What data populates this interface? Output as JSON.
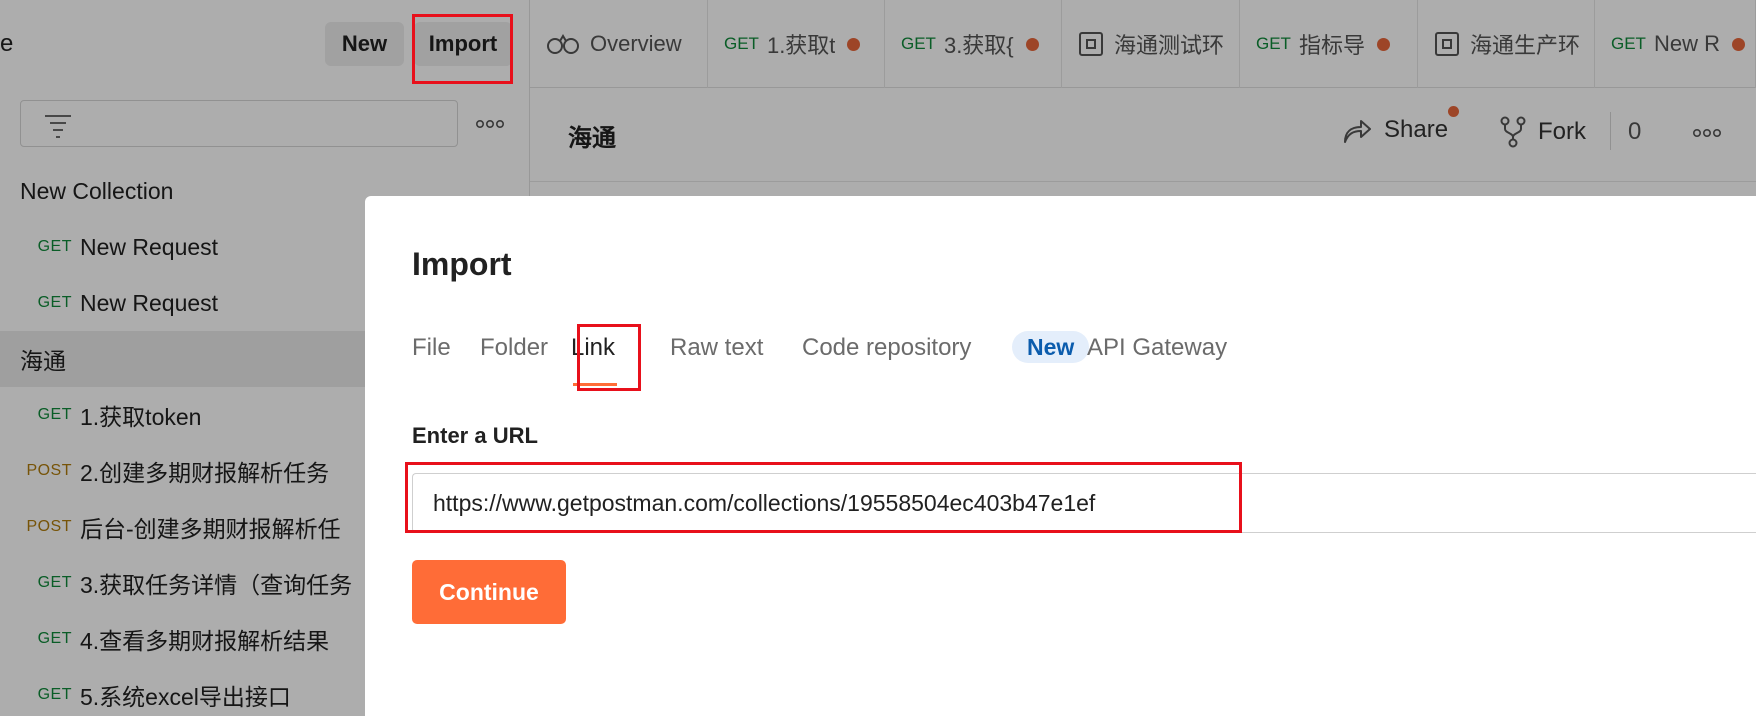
{
  "colors": {
    "accent": "#ff6c37",
    "get_method": "#0f8a3a",
    "post_method": "#b07c0c",
    "unsaved_dot": "#e8663a",
    "highlight_box": "#e8101b",
    "new_badge_bg": "#e4eefb",
    "new_badge_text": "#0b5cad"
  },
  "sidebar": {
    "title_fragment": "e",
    "new_label": "New",
    "import_label": "Import",
    "filter_icon": "filter-icon",
    "more_icon": "more-icon",
    "tree": [
      {
        "kind": "collection",
        "label": "New Collection"
      },
      {
        "kind": "request",
        "method": "GET",
        "label": "New Request"
      },
      {
        "kind": "request",
        "method": "GET",
        "label": "New Request"
      },
      {
        "kind": "collection",
        "label": "海通",
        "active": true
      },
      {
        "kind": "request",
        "method": "GET",
        "label": "1.获取token"
      },
      {
        "kind": "request",
        "method": "POST",
        "label": "2.创建多期财报解析任务"
      },
      {
        "kind": "request",
        "method": "POST",
        "label": "后台-创建多期财报解析任"
      },
      {
        "kind": "request",
        "method": "GET",
        "label": "3.获取任务详情（查询任务"
      },
      {
        "kind": "request",
        "method": "GET",
        "label": "4.查看多期财报解析结果"
      },
      {
        "kind": "request",
        "method": "GET",
        "label": "5.系统excel导出接口"
      }
    ]
  },
  "tabs": [
    {
      "icon": "overview-icon",
      "label": "Overview"
    },
    {
      "method": "GET",
      "label": "1.获取t",
      "unsaved": true
    },
    {
      "method": "GET",
      "label": "3.获取{",
      "unsaved": true
    },
    {
      "icon": "environment-icon",
      "label": "海通测试环"
    },
    {
      "method": "GET",
      "label": "指标导",
      "unsaved": true
    },
    {
      "icon": "environment-icon",
      "label": "海通生产环"
    },
    {
      "method": "GET",
      "label": "New R",
      "unsaved": true
    }
  ],
  "workspace": {
    "title": "海通",
    "share_label": "Share",
    "fork_label": "Fork",
    "fork_count": "0"
  },
  "modal": {
    "title": "Import",
    "tabs": [
      {
        "label": "File"
      },
      {
        "label": "Folder"
      },
      {
        "label": "Link",
        "active": true
      },
      {
        "label": "Raw text"
      },
      {
        "label": "Code repository",
        "badge": "New"
      },
      {
        "label": "API Gateway"
      }
    ],
    "url_label": "Enter a URL",
    "url_value": "https://www.getpostman.com/collections/19558504ec403b47e1ef",
    "continue_label": "Continue"
  }
}
